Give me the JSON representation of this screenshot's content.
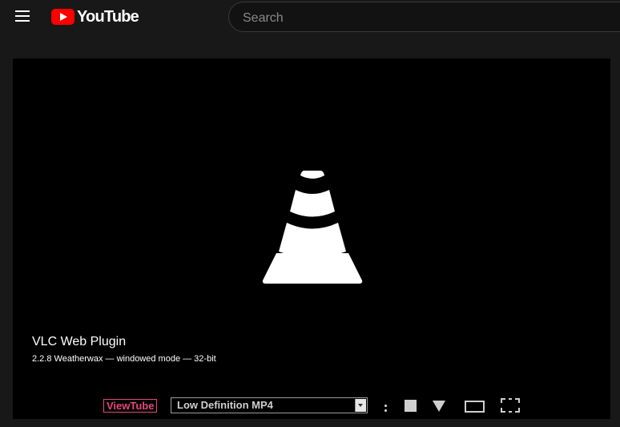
{
  "header": {
    "menu_icon": "hamburger-menu-icon",
    "logo_text": "YouTube",
    "logo_color": "#ff0000",
    "search_placeholder": "Search"
  },
  "player": {
    "background": "#000000",
    "logo_icon": "vlc-cone-icon",
    "plugin_title": "VLC Web Plugin",
    "plugin_version": "2.2.8 Weatherwax — windowed mode — 32-bit"
  },
  "controls": {
    "viewtube_label": "ViewTube",
    "viewtube_color": "#e8467a",
    "quality_selected": "Low Definition MP4",
    "icons": [
      "more-icon",
      "stop-icon",
      "download-icon",
      "widescreen-icon",
      "fullscreen-icon"
    ]
  }
}
